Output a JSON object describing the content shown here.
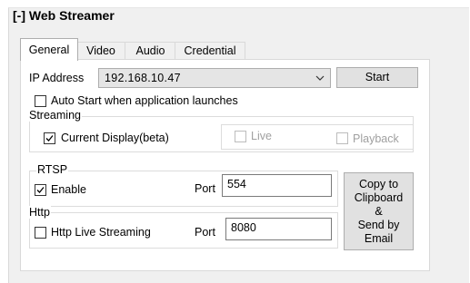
{
  "header": {
    "title": "[-] Web Streamer"
  },
  "tabs": [
    {
      "label": "General"
    },
    {
      "label": "Video"
    },
    {
      "label": "Audio"
    },
    {
      "label": "Credential"
    }
  ],
  "general": {
    "ip_label": "IP Address",
    "ip_value": "192.168.10.47",
    "start_label": "Start",
    "auto_start_label": "Auto Start when application launches",
    "auto_start_checked": false,
    "streaming": {
      "label": "Streaming",
      "current_display_label": "Current Display(beta)",
      "current_display_checked": true,
      "live_label": "Live",
      "playback_label": "Playback"
    },
    "rtsp": {
      "label": "RTSP",
      "enable_label": "Enable",
      "enable_checked": true,
      "port_label": "Port",
      "port_value": "554"
    },
    "http": {
      "label": "Http",
      "hls_label": "Http Live Streaming",
      "hls_checked": false,
      "port_label": "Port",
      "port_value": "8080"
    },
    "copy_button": {
      "line1": "Copy to",
      "line2": "Clipboard",
      "line3": "&",
      "line4": "Send by",
      "line5": "Email"
    }
  }
}
